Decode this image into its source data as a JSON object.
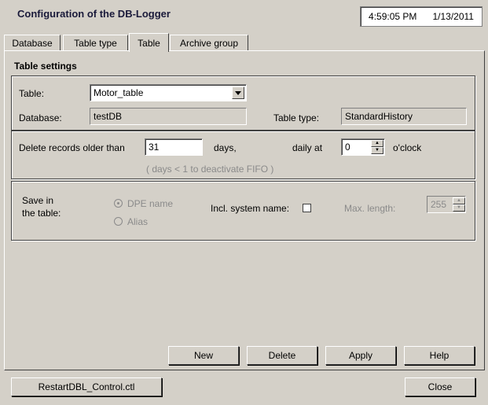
{
  "window": {
    "title": "Configuration of the DB-Logger",
    "time": "4:59:05 PM",
    "date": "1/13/2011"
  },
  "tabs": [
    {
      "label": "Database"
    },
    {
      "label": "Table type"
    },
    {
      "label": "Table",
      "active": true
    },
    {
      "label": "Archive group"
    }
  ],
  "table_settings": {
    "group_title": "Table settings",
    "table_label": "Table:",
    "table_value": "Motor_table",
    "database_label": "Database:",
    "database_value": "testDB",
    "table_type_label": "Table type:",
    "table_type_value": "StandardHistory"
  },
  "fifo": {
    "delete_label": "Delete records older than",
    "days_value": "31",
    "days_label": "days,",
    "daily_at_label": "daily at",
    "hour_value": "0",
    "oclock_label": "o'clock",
    "hint": "( days < 1 to deactivate FIFO )"
  },
  "save": {
    "save_in_label_1": "Save in",
    "save_in_label_2": "the table:",
    "dpe_name_label": "DPE name",
    "alias_label": "Alias",
    "selected": "DPE name",
    "incl_system_label": "Incl. system name:",
    "incl_system_checked": false,
    "max_length_label": "Max. length:",
    "max_length_value": "255"
  },
  "actions": {
    "new_label": "New",
    "delete_label": "Delete",
    "apply_label": "Apply",
    "help_label": "Help",
    "restart_label": "RestartDBL_Control.ctl",
    "close_label": "Close"
  }
}
